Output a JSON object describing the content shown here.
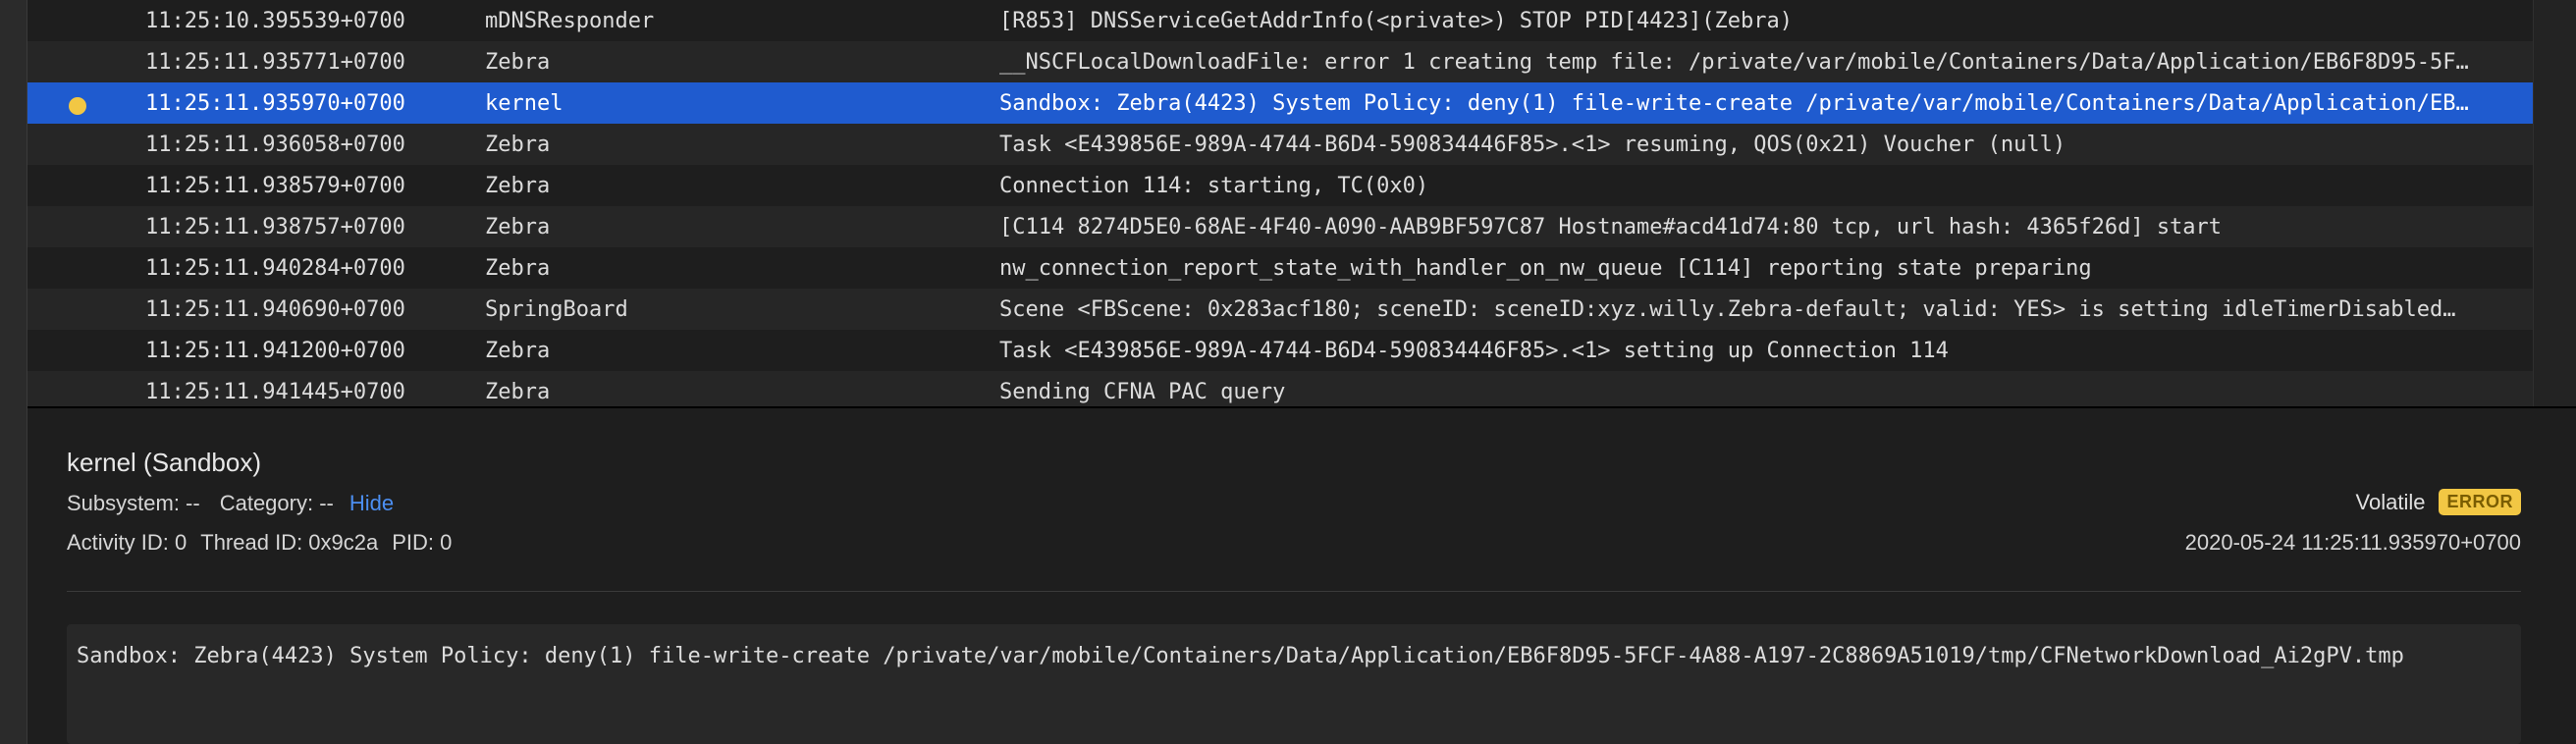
{
  "log_rows": [
    {
      "time": "11:25:10.395539+0700",
      "process": "mDNSResponder",
      "message": "[R853] DNSServiceGetAddrInfo(<private>) STOP PID[4423](Zebra)",
      "selected": false,
      "has_dot": false
    },
    {
      "time": "11:25:11.935771+0700",
      "process": "Zebra",
      "message": "__NSCFLocalDownloadFile: error 1 creating temp file: /private/var/mobile/Containers/Data/Application/EB6F8D95-5F…",
      "selected": false,
      "has_dot": false
    },
    {
      "time": "11:25:11.935970+0700",
      "process": "kernel",
      "message": "Sandbox: Zebra(4423) System Policy: deny(1) file-write-create /private/var/mobile/Containers/Data/Application/EB…",
      "selected": true,
      "has_dot": true
    },
    {
      "time": "11:25:11.936058+0700",
      "process": "Zebra",
      "message": "Task <E439856E-989A-4744-B6D4-590834446F85>.<1> resuming, QOS(0x21) Voucher (null)",
      "selected": false,
      "has_dot": false
    },
    {
      "time": "11:25:11.938579+0700",
      "process": "Zebra",
      "message": "Connection 114: starting, TC(0x0)",
      "selected": false,
      "has_dot": false
    },
    {
      "time": "11:25:11.938757+0700",
      "process": "Zebra",
      "message": "[C114 8274D5E0-68AE-4F40-A090-AAB9BF597C87 Hostname#acd41d74:80 tcp, url hash: 4365f26d] start",
      "selected": false,
      "has_dot": false
    },
    {
      "time": "11:25:11.940284+0700",
      "process": "Zebra",
      "message": "nw_connection_report_state_with_handler_on_nw_queue [C114] reporting state preparing",
      "selected": false,
      "has_dot": false
    },
    {
      "time": "11:25:11.940690+0700",
      "process": "SpringBoard",
      "message": "Scene <FBScene: 0x283acf180; sceneID: sceneID:xyz.willy.Zebra-default; valid: YES> is setting idleTimerDisabled…",
      "selected": false,
      "has_dot": false
    },
    {
      "time": "11:25:11.941200+0700",
      "process": "Zebra",
      "message": "Task <E439856E-989A-4744-B6D4-590834446F85>.<1> setting up Connection 114",
      "selected": false,
      "has_dot": false
    },
    {
      "time": "11:25:11.941445+0700",
      "process": "Zebra",
      "message": "Sending CFNA PAC query",
      "selected": false,
      "has_dot": false
    }
  ],
  "detail": {
    "title": "kernel (Sandbox)",
    "subsystem": "Subsystem: --",
    "category": "Category: --",
    "hide_label": "Hide",
    "activity_id": "Activity ID: 0",
    "thread_id": "Thread ID: 0x9c2a",
    "pid": "PID: 0",
    "volatile_label": "Volatile",
    "level_badge": "ERROR",
    "timestamp": "2020-05-24 11:25:11.935970+0700",
    "message": "Sandbox: Zebra(4423) System Policy: deny(1) file-write-create /private/var/mobile/Containers/Data/Application/EB6F8D95-5FCF-4A88-A197-2C8869A51019/tmp/CFNetworkDownload_Ai2gPV.tmp"
  },
  "colors": {
    "selection": "#1f5bcf",
    "error_badge": "#f2c744",
    "link": "#4c8ff2",
    "fault_dot": "#f2c744"
  }
}
